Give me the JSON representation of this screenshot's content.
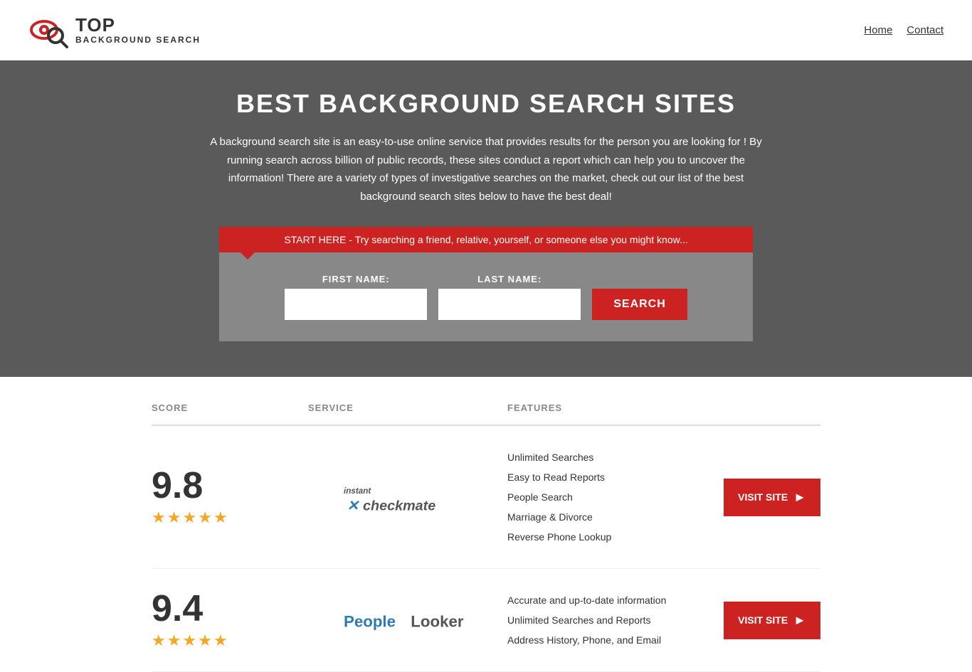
{
  "header": {
    "logo_top": "TOP",
    "logo_bottom": "BACKGROUND SEARCH",
    "nav_home": "Home",
    "nav_contact": "Contact"
  },
  "hero": {
    "title": "BEST BACKGROUND SEARCH SITES",
    "description": "A background search site is an easy-to-use online service that provides results  for the person you are looking for ! By  running  search across billion of public records, these sites conduct  a report which can help you to uncover the information! There are a variety of types of investigative searches on the market, check out our  list of the best background search sites below to have the best deal!",
    "search_prompt": "START HERE - Try searching a friend, relative, yourself, or someone else you might know...",
    "first_name_label": "FIRST NAME:",
    "last_name_label": "LAST NAME:",
    "search_button": "SEARCH",
    "first_name_placeholder": "",
    "last_name_placeholder": ""
  },
  "table": {
    "col_score": "SCORE",
    "col_service": "SERVICE",
    "col_features": "FEATURES"
  },
  "results": [
    {
      "score": "9.8",
      "stars": 4.5,
      "service_name": "Instant Checkmate",
      "features": [
        "Unlimited Searches",
        "Easy to Read Reports",
        "People Search",
        "Marriage & Divorce",
        "Reverse Phone Lookup"
      ],
      "visit_label": "VISIT SITE"
    },
    {
      "score": "9.4",
      "stars": 4.5,
      "service_name": "PeopleLooker",
      "features": [
        "Accurate and up-to-date information",
        "Unlimited Searches and Reports",
        "Address History, Phone, and Email"
      ],
      "visit_label": "VISIT SITE"
    }
  ]
}
